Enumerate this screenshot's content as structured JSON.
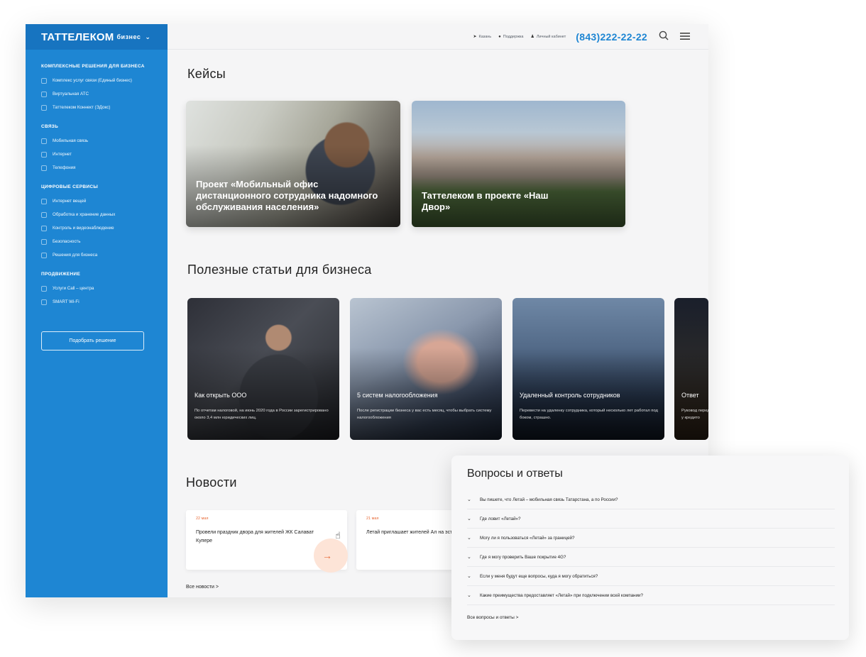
{
  "brand": {
    "name": "ТАТТЕЛЕКОМ",
    "suffix": "бизнес",
    "chevron_icon": "chevron-down-icon"
  },
  "nav": {
    "groups": [
      {
        "title": "КОМПЛЕКСНЫЕ РЕШЕНИЯ ДЛЯ БИЗНЕСА",
        "items": [
          "Комплекс услуг связи (Единый бизнес)",
          "Виртуальная АТС",
          "Таттелеком Коннект (ЭДокс)"
        ]
      },
      {
        "title": "СВЯЗЬ",
        "items": [
          "Мобильная связь",
          "Интернет",
          "Телефония"
        ]
      },
      {
        "title": "ЦИФРОВЫЕ СЕРВИСЫ",
        "items": [
          "Интернет вещей",
          "Обработка и хранение данных",
          "Контроль и видеонаблюдение",
          "Безопасность",
          "Решения для бизнеса"
        ]
      },
      {
        "title": "ПРОДВИЖЕНИЕ",
        "items": [
          "Услуги Call – центра",
          "SMART Wi-Fi"
        ]
      }
    ],
    "pick_button": "Подобрать решение"
  },
  "topbar": {
    "city": "Казань",
    "support": "Поддержка",
    "cabinet": "Личный кабинет",
    "phone": "(843)222-22-22"
  },
  "cases": {
    "title": "Кейсы",
    "items": [
      {
        "caption": "Проект «Мобильный офис дистанционного сотрудника надомного обслуживания населения»"
      },
      {
        "caption": "Таттелеком в проекте «Наш Двор»"
      }
    ]
  },
  "articles": {
    "title": "Полезные статьи для бизнеса",
    "items": [
      {
        "title": "Как открыть ООО",
        "desc": "По отчетам налоговой, на июнь 2020 года в России зарегистрировано около 3,4 млн юридических лиц."
      },
      {
        "title": "5 систем налогообложения",
        "desc": "После регистрации бизнеса у вас есть месяц, чтобы выбрать систему налогообложения"
      },
      {
        "title": "Удаленный контроль сотрудников",
        "desc": "Перевести на удаленку сотрудника, который несколько лет работал под боком, страшно."
      },
      {
        "title": "Ответ",
        "desc": "Руковод перед у кредито"
      }
    ]
  },
  "news": {
    "title": "Новости",
    "items": [
      {
        "date": "22 мая",
        "text": "Провели праздник двора для жителей ЖК Салават Купере"
      },
      {
        "date": "21 мая",
        "text": "Летай приглашает жителей Ал на эстафету"
      }
    ],
    "all": "Все новости >"
  },
  "faq": {
    "title": "Вопросы и ответы",
    "items": [
      "Вы пишете, что Летай – мобильная связь Татарстана, а по России?",
      "Где ловит «Летай»?",
      "Могу ли я пользоваться «Летай» за границей?",
      "Где я могу проверить Ваше покрытие 4G?",
      "Если у меня будут еще вопросы, куда я могу обратиться?",
      "Какие преимущества предоставляет «Летай» при подключении всей компании?"
    ],
    "all": "Все вопросы и ответы >"
  },
  "colors": {
    "brand_blue": "#1e86d3",
    "accent_orange": "#e86c3a"
  }
}
